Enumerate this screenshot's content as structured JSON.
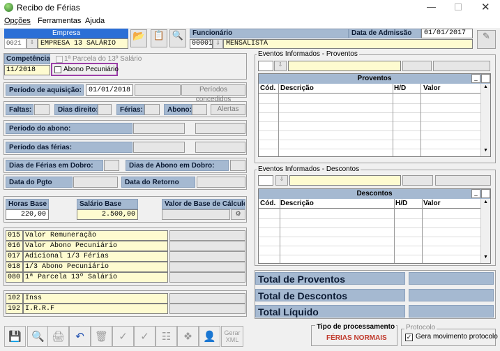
{
  "window": {
    "title": "Recibo de Férias"
  },
  "menu": {
    "opcoes": "Opções",
    "ferramentas": "Ferramentas",
    "ajuda": "Ajuda"
  },
  "empresa": {
    "label": "Empresa",
    "code": "0021",
    "name": "EMPRESA 13 SALÁRIO"
  },
  "funcionario": {
    "label": "Funcionário",
    "code": "00001",
    "name": "MENSALISTA",
    "data_admissao_label": "Data de Admissão",
    "data_admissao": "01/01/2017"
  },
  "competencia": {
    "label": "Competência",
    "value": "11/2018",
    "parcela_13": "1ª Parcela do 13º Salário",
    "abono_pecuniario": "Abono Pecuniário"
  },
  "periodo_aquisicao": {
    "label": "Período de aquisição:",
    "value": "01/01/2018",
    "periodos_btn": "Períodos concedidos"
  },
  "row_faltas": {
    "faltas": "Faltas:",
    "dias_direito": "Dias direito:",
    "ferias": "Férias:",
    "abono": "Abono:",
    "alertas": "Alertas"
  },
  "periodo_abono": {
    "label": "Período do abono:"
  },
  "periodo_ferias": {
    "label": "Período das férias:"
  },
  "dobro": {
    "ferias": "Dias de Férias em Dobro:",
    "abono": "Dias de Abono em Dobro:"
  },
  "datas": {
    "pgto": "Data do Pgto",
    "retorno": "Data do Retorno"
  },
  "base": {
    "horas_label": "Horas Base",
    "horas": "220,00",
    "salario_label": "Salário Base",
    "salario": "2.500,00",
    "valor_calc_label": "Valor de Base de Cálculo"
  },
  "eventos_list": [
    {
      "code": "015",
      "desc": "Valor Remuneração"
    },
    {
      "code": "016",
      "desc": "Valor Abono Pecuniário"
    },
    {
      "code": "017",
      "desc": "Adicional 1/3 Férias"
    },
    {
      "code": "018",
      "desc": "1/3 Abono Pecuniário"
    },
    {
      "code": "080",
      "desc": "1ª Parcela 13º Salário"
    }
  ],
  "eventos_list2": [
    {
      "code": "102",
      "desc": "Inss"
    },
    {
      "code": "192",
      "desc": "I.R.R.F"
    }
  ],
  "proventos": {
    "group": "Eventos Informados - Proventos",
    "title": "Proventos",
    "cols": [
      "Cód.",
      "Descrição",
      "H/D",
      "Valor"
    ]
  },
  "descontos": {
    "group": "Eventos Informados - Descontos",
    "title": "Descontos",
    "cols": [
      "Cód.",
      "Descrição",
      "H/D",
      "Valor"
    ]
  },
  "totais": {
    "proventos": "Total de Proventos",
    "descontos": "Total de Descontos",
    "liquido": "Total Líquido"
  },
  "processamento": {
    "label": "Tipo de processamento",
    "value": "FÉRIAS NORMAIS"
  },
  "protocolo": {
    "label": "Protocolo",
    "checkbox": "Gera movimento protocolo"
  },
  "toolbar": {
    "gerar_xml": "Gerar XML"
  },
  "colors": {
    "label_bg": "#a5b9d1",
    "field_yellow": "#fefbd0",
    "highlight_border": "#9b3fa8",
    "accent_red": "#c0392b"
  }
}
